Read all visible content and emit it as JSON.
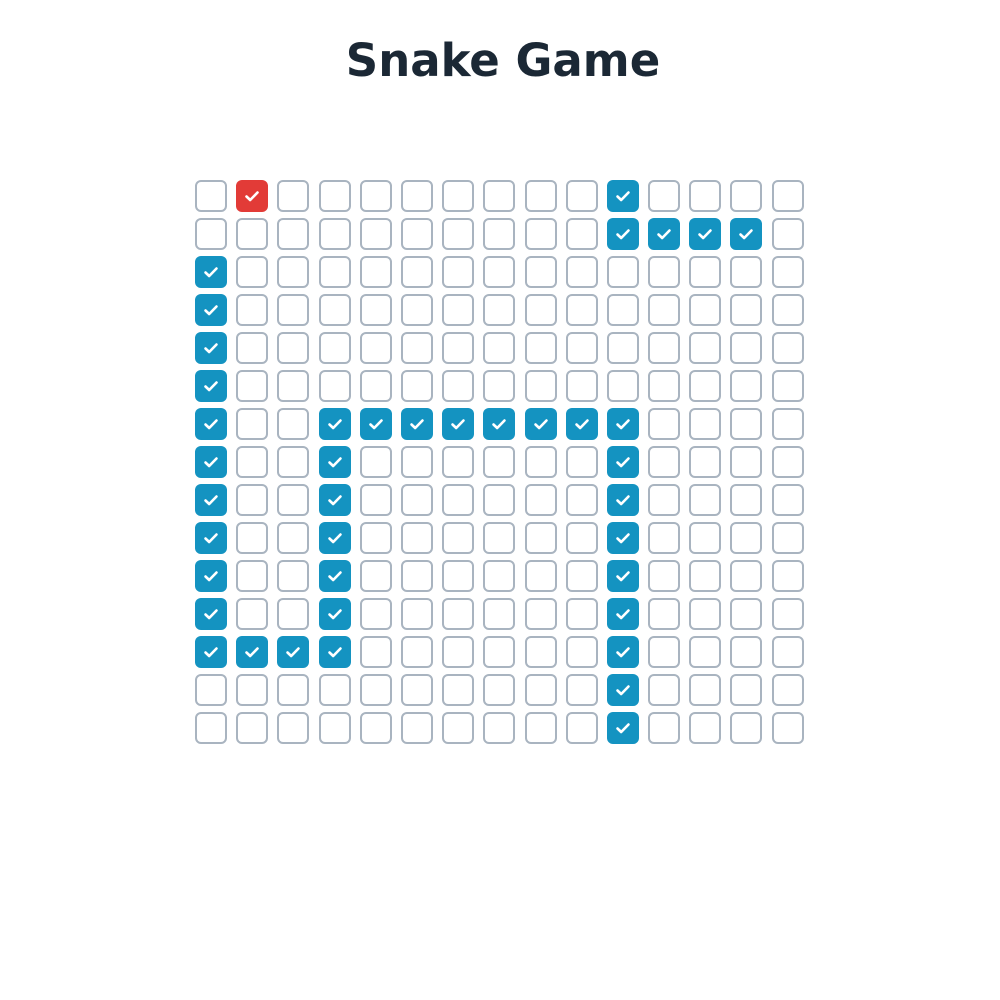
{
  "title": "Snake Game",
  "colors": {
    "snake": "#1493c1",
    "food": "#e23b37",
    "empty_border": "#a9b4c0",
    "check": "#ffffff"
  },
  "icon": "check-icon",
  "grid": {
    "rows": 15,
    "cols": 15,
    "food": [
      0,
      1
    ],
    "snake": [
      [
        0,
        10
      ],
      [
        1,
        10
      ],
      [
        1,
        11
      ],
      [
        1,
        12
      ],
      [
        1,
        13
      ],
      [
        2,
        0
      ],
      [
        3,
        0
      ],
      [
        4,
        0
      ],
      [
        5,
        0
      ],
      [
        6,
        0
      ],
      [
        7,
        0
      ],
      [
        8,
        0
      ],
      [
        9,
        0
      ],
      [
        10,
        0
      ],
      [
        11,
        0
      ],
      [
        12,
        0
      ],
      [
        12,
        1
      ],
      [
        12,
        2
      ],
      [
        12,
        3
      ],
      [
        11,
        3
      ],
      [
        10,
        3
      ],
      [
        9,
        3
      ],
      [
        8,
        3
      ],
      [
        7,
        3
      ],
      [
        6,
        3
      ],
      [
        6,
        4
      ],
      [
        6,
        5
      ],
      [
        6,
        6
      ],
      [
        6,
        7
      ],
      [
        6,
        8
      ],
      [
        6,
        9
      ],
      [
        6,
        10
      ],
      [
        7,
        10
      ],
      [
        8,
        10
      ],
      [
        9,
        10
      ],
      [
        10,
        10
      ],
      [
        11,
        10
      ],
      [
        12,
        10
      ],
      [
        13,
        10
      ],
      [
        14,
        10
      ]
    ]
  }
}
